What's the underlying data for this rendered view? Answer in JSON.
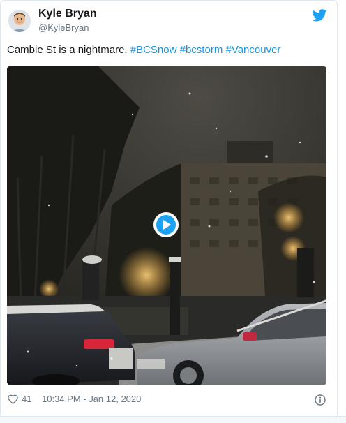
{
  "author": {
    "name": "Kyle Bryan",
    "handle": "@KyleBryan",
    "avatar_icon": "memoji-avatar-icon"
  },
  "platform_icon": "twitter-bird-icon",
  "brand_color": "#1da1f2",
  "tweet": {
    "text": "Cambie St is a nightmare.",
    "hashtags": [
      "#BCSnow",
      "#bcstorm",
      "#Vancouver"
    ]
  },
  "media": {
    "type": "video",
    "play_icon": "play-icon"
  },
  "footer": {
    "like_icon": "heart-icon",
    "likes": "41",
    "timestamp": "10:34 PM - Jan 12, 2020",
    "info_icon": "info-icon"
  }
}
